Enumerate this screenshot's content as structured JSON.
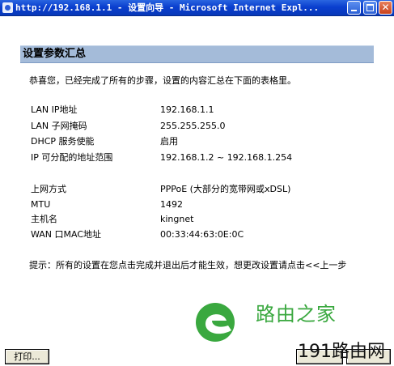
{
  "window": {
    "title": "http://192.168.1.1 - 设置向导 - Microsoft Internet Expl..."
  },
  "section": {
    "title": "设置参数汇总"
  },
  "intro": "恭喜您，已经完成了所有的步骤，设置的内容汇总在下面的表格里。",
  "rows": [
    {
      "label": "LAN IP地址",
      "value": "192.168.1.1"
    },
    {
      "label": "LAN 子网掩码",
      "value": "255.255.255.0"
    },
    {
      "label": "DHCP 服务使能",
      "value": "启用"
    },
    {
      "label": "IP 可分配的地址范围",
      "value": "192.168.1.2 ~ 192.168.1.254"
    },
    {
      "label": "上网方式",
      "value": "PPPoE (大部分的宽带网或xDSL)"
    },
    {
      "label": "MTU",
      "value": "1492"
    },
    {
      "label": "主机名",
      "value": "kingnet"
    },
    {
      "label": "WAN 口MAC地址",
      "value": "00:33:44:63:0E:0C"
    }
  ],
  "note": "提示：所有的设置在您点击完成并退出后才能生效，想更改设置请点击<<上一步",
  "buttons": {
    "print": "打印..."
  },
  "watermark": {
    "brand": "路由之家",
    "site": "191路由网"
  },
  "colors": {
    "titlebar": "#0a3fcf",
    "section_header": "#a4bbd9",
    "watermark_green": "#3aa83f"
  }
}
